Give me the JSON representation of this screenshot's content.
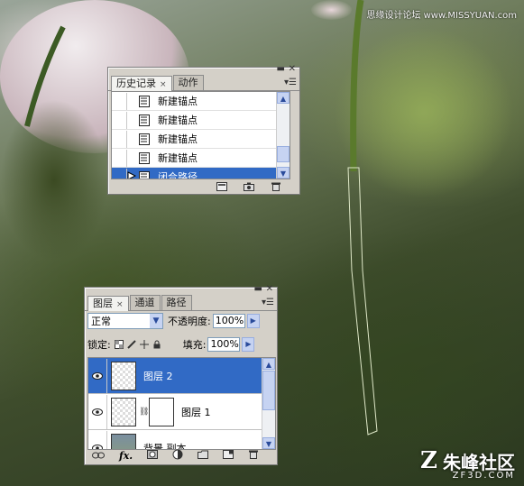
{
  "watermark": {
    "top_text": "思缘设计论坛 www.MISSYUAN.com",
    "bottom_brand": "朱峰社区",
    "bottom_domain": "ZF3D.COM"
  },
  "history_panel": {
    "tabs": [
      {
        "label": "历史记录",
        "active": true,
        "closable": true
      },
      {
        "label": "动作",
        "active": false,
        "closable": false
      }
    ],
    "close_glyph": "×",
    "items": [
      {
        "label": "新建锚点",
        "selected": false
      },
      {
        "label": "新建锚点",
        "selected": false
      },
      {
        "label": "新建锚点",
        "selected": false
      },
      {
        "label": "新建锚点",
        "selected": false
      },
      {
        "label": "闭合路径",
        "selected": true
      }
    ],
    "footer_icons": [
      "new-document-icon",
      "camera-snapshot-icon",
      "trash-icon"
    ]
  },
  "layers_panel": {
    "tabs": [
      {
        "label": "图层",
        "active": true,
        "closable": true
      },
      {
        "label": "通道",
        "active": false,
        "closable": false
      },
      {
        "label": "路径",
        "active": false,
        "closable": false
      }
    ],
    "close_glyph": "×",
    "blend_mode": "正常",
    "opacity_label": "不透明度:",
    "opacity_value": "100%",
    "lock_label": "锁定:",
    "fill_label": "填充:",
    "fill_value": "100%",
    "layers": [
      {
        "name": "图层 2",
        "selected": true,
        "visible": true,
        "has_mask": false
      },
      {
        "name": "图层 1",
        "selected": false,
        "visible": true,
        "has_mask": true
      },
      {
        "name": "背景 副本",
        "selected": false,
        "visible": true,
        "has_mask": false
      }
    ],
    "footer_icons": [
      "link-icon",
      "fx-icon",
      "mask-icon",
      "adjustment-icon",
      "folder-icon",
      "new-layer-icon",
      "trash-icon"
    ],
    "fx_label": "fx."
  },
  "colors": {
    "selection": "#316ac5",
    "panel_bg": "#d4d0c8",
    "path_stroke": "#dfe8c8"
  }
}
